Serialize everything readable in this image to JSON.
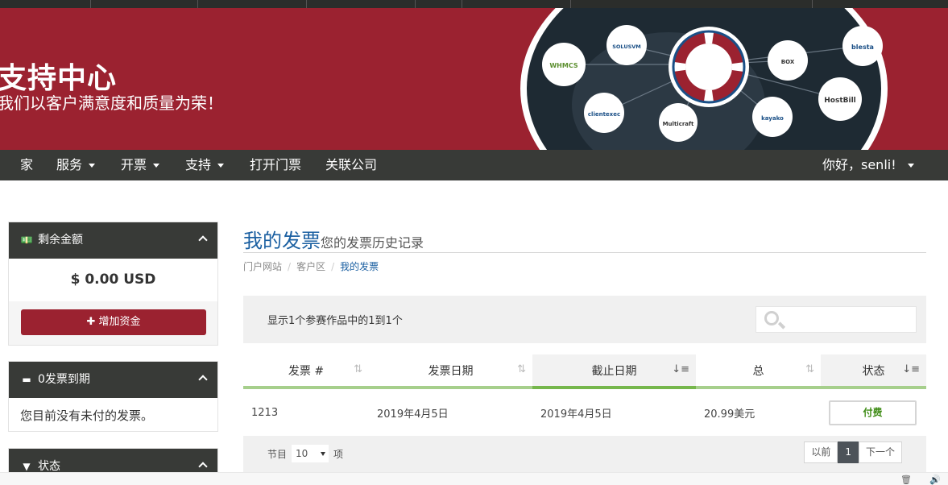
{
  "hero": {
    "title": "支持中心",
    "subtitle": "我们以客户满意度和质量为荣！",
    "logos": [
      "WHMCS",
      "SOLUSVM",
      "clientexec",
      "Multicraft",
      "BOX BILLING",
      "blesta",
      "HostBill",
      "kayako"
    ],
    "brand_color": "#9b2230"
  },
  "nav": {
    "items": [
      {
        "label": "家"
      },
      {
        "label": "服务"
      },
      {
        "label": "开票"
      },
      {
        "label": "支持"
      },
      {
        "label": "打开门票"
      },
      {
        "label": "关联公司"
      }
    ],
    "user": "你好，senli!"
  },
  "sidebar": {
    "balance": {
      "title": "剩余金额",
      "amount": "$ 0.00 USD",
      "button": "增加资金"
    },
    "due": {
      "title": "0发票到期",
      "text": "您目前没有未付的发票。"
    },
    "status": {
      "title": "状态"
    }
  },
  "main": {
    "title": "我的发票",
    "subtitle": "您的发票历史记录",
    "breadcrumb": [
      "门户网站",
      "客户区",
      "我的发票"
    ],
    "table_info": "显示1个参赛作品中的1到1个",
    "columns": [
      "发票 #",
      "发票日期",
      "截止日期",
      "总",
      "状态"
    ],
    "rows": [
      {
        "number": "1213",
        "invoice_date": "2019年4月5日",
        "due_date": "2019年4月5日",
        "total": "20.99美元",
        "status": "付费"
      }
    ],
    "per_page_label_before": "节目",
    "per_page_value": "10",
    "per_page_label_after": "项",
    "pager": {
      "prev": "以前",
      "current": "1",
      "next": "下一个"
    }
  },
  "colors": {
    "accent": "#1a5fa1",
    "paid": "#3f8c16",
    "nav_bg": "#383a37"
  }
}
